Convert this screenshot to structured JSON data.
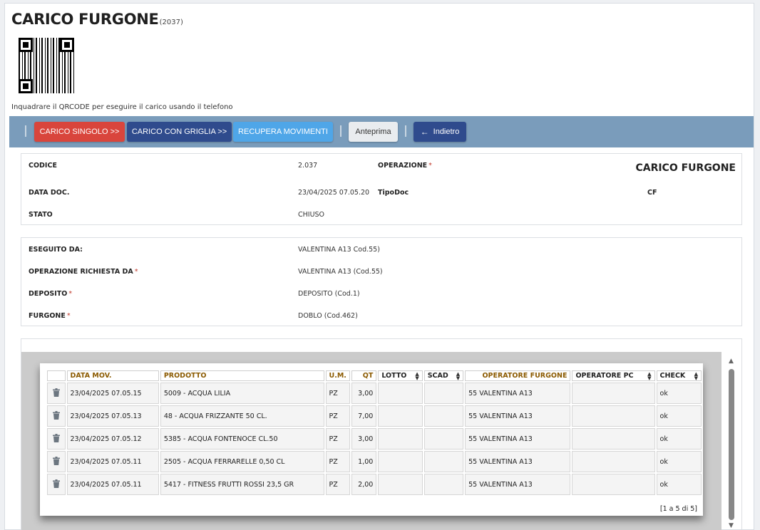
{
  "header": {
    "title": "CARICO FURGONE",
    "code": "(2037)",
    "qr_note": "Inquadrare il QRCODE per eseguire il carico usando il telefono"
  },
  "toolbar": {
    "carico_singolo": "CARICO SINGOLO >>",
    "carico_griglia": "CARICO CON GRIGLIA >>",
    "recupera": "RECUPERA MOVIMENTI",
    "anteprima": "Anteprima",
    "indietro": "Indietro"
  },
  "info": {
    "codice_label": "CODICE",
    "codice_value": "2.037",
    "operazione_label": "OPERAZIONE",
    "operazione_value": "CARICO FURGONE",
    "data_label": "DATA DOC.",
    "data_value": "23/04/2025 07.05.20",
    "tipodoc_label": "TipoDoc",
    "tipodoc_value": "CF",
    "stato_label": "STATO",
    "stato_value": "CHIUSO"
  },
  "details": {
    "eseguito_label": "ESEGUITO DA:",
    "eseguito_value": "VALENTINA A13 Cod.55)",
    "richiesta_label": "OPERAZIONE RICHIESTA DA",
    "richiesta_value": "VALENTINA A13 (Cod.55)",
    "deposito_label": "DEPOSITO",
    "deposito_value": "DEPOSITO (Cod.1)",
    "furgone_label": "FURGONE",
    "furgone_value": "DOBLO (Cod.462)"
  },
  "grid": {
    "columns": [
      "DATA MOV.",
      "PRODOTTO",
      "U.M.",
      "QT",
      "LOTTO",
      "SCAD",
      "OPERATORE FURGONE",
      "OPERATORE PC",
      "CHECK"
    ],
    "rows": [
      {
        "data": "23/04/2025 07.05.15",
        "prodotto": "5009 - ACQUA LILIA",
        "um": "PZ",
        "qt": "3,00",
        "lotto": "",
        "scad": "",
        "op_furgone": "55 VALENTINA A13",
        "op_pc": "",
        "check": "ok"
      },
      {
        "data": "23/04/2025 07.05.13",
        "prodotto": "48 - ACQUA FRIZZANTE 50 CL.",
        "um": "PZ",
        "qt": "7,00",
        "lotto": "",
        "scad": "",
        "op_furgone": "55 VALENTINA A13",
        "op_pc": "",
        "check": "ok"
      },
      {
        "data": "23/04/2025 07.05.12",
        "prodotto": "5385 - ACQUA FONTENOCE CL.50",
        "um": "PZ",
        "qt": "3,00",
        "lotto": "",
        "scad": "",
        "op_furgone": "55 VALENTINA A13",
        "op_pc": "",
        "check": "ok"
      },
      {
        "data": "23/04/2025 07.05.11",
        "prodotto": "2505 - ACQUA FERRARELLE 0,50 CL",
        "um": "PZ",
        "qt": "1,00",
        "lotto": "",
        "scad": "",
        "op_furgone": "55 VALENTINA A13",
        "op_pc": "",
        "check": "ok"
      },
      {
        "data": "23/04/2025 07.05.11",
        "prodotto": "5417 - FITNESS FRUTTI ROSSI 23,5 GR",
        "um": "PZ",
        "qt": "2,00",
        "lotto": "",
        "scad": "",
        "op_furgone": "55 VALENTINA A13",
        "op_pc": "",
        "check": "ok"
      }
    ],
    "pager": "[1 a 5 di 5]"
  },
  "icons": {
    "trash": "trash-icon",
    "back": "arrow-left-icon",
    "qr": "qr-code"
  },
  "colors": {
    "toolbar": "#7a9cbb",
    "red": "#d9453c",
    "navy": "#2f4b8d",
    "sky": "#4fa6e8",
    "header_text": "#8b5a00"
  }
}
